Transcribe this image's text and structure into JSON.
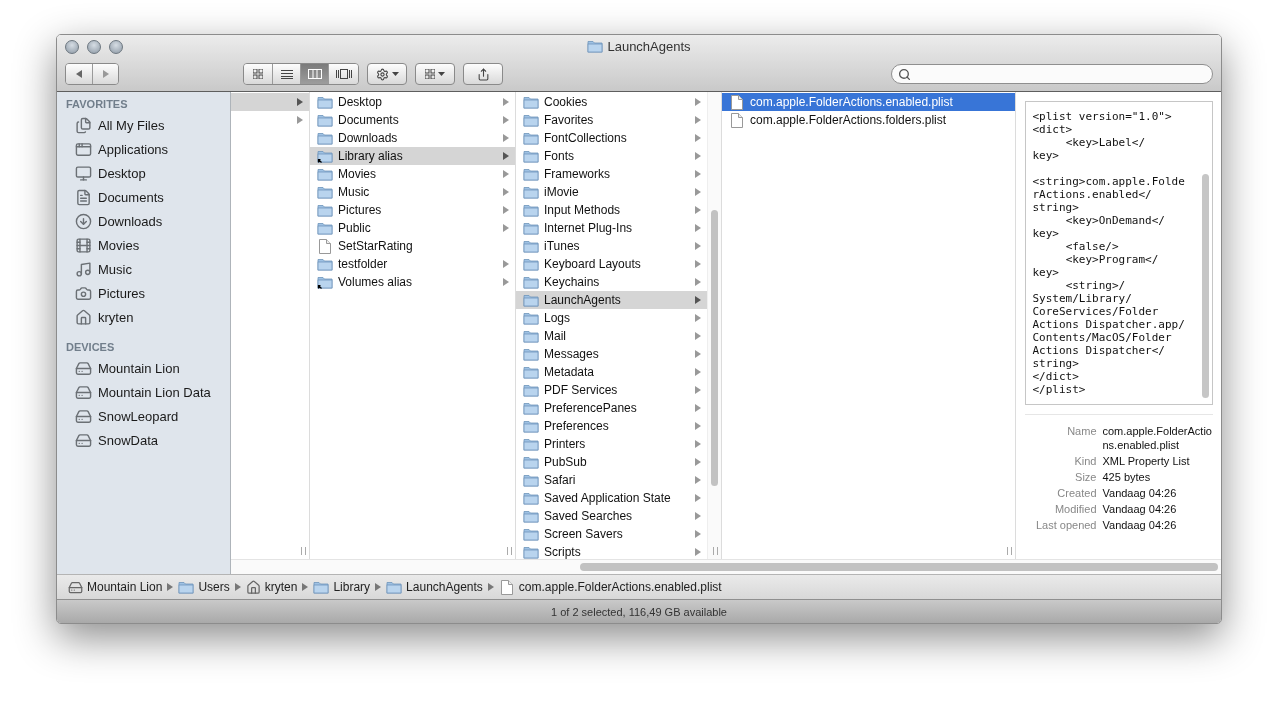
{
  "window": {
    "title": "LaunchAgents"
  },
  "toolbar": {
    "view_modes": [
      {
        "selected": false
      },
      {
        "selected": false
      },
      {
        "selected": true
      },
      {
        "selected": false
      }
    ]
  },
  "sidebar": {
    "sections": [
      {
        "heading": "FAVORITES",
        "items": [
          {
            "label": "All My Files"
          },
          {
            "label": "Applications"
          },
          {
            "label": "Desktop"
          },
          {
            "label": "Documents"
          },
          {
            "label": "Downloads"
          },
          {
            "label": "Movies"
          },
          {
            "label": "Music"
          },
          {
            "label": "Pictures"
          },
          {
            "label": "kryten"
          }
        ]
      },
      {
        "heading": "DEVICES",
        "items": [
          {
            "label": "Mountain Lion"
          },
          {
            "label": "Mountain Lion Data"
          },
          {
            "label": "SnowLeopard"
          },
          {
            "label": "SnowData"
          }
        ]
      }
    ]
  },
  "columns": [
    {
      "focused": false,
      "rows": [
        {
          "kind": "blank",
          "has_children": true,
          "selected": true
        },
        {
          "kind": "blank",
          "has_children": true,
          "selected": false
        }
      ]
    },
    {
      "focused": false,
      "rows": [
        {
          "label": "Desktop",
          "kind": "folder",
          "alias": false,
          "has_children": true,
          "selected": false
        },
        {
          "label": "Documents",
          "kind": "folder",
          "alias": false,
          "has_children": true,
          "selected": false
        },
        {
          "label": "Downloads",
          "kind": "folder",
          "alias": false,
          "has_children": true,
          "selected": false
        },
        {
          "label": "Library alias",
          "kind": "folder",
          "alias": true,
          "has_children": true,
          "selected": true
        },
        {
          "label": "Movies",
          "kind": "folder",
          "alias": false,
          "has_children": true,
          "selected": false
        },
        {
          "label": "Music",
          "kind": "folder",
          "alias": false,
          "has_children": true,
          "selected": false
        },
        {
          "label": "Pictures",
          "kind": "folder",
          "alias": false,
          "has_children": true,
          "selected": false
        },
        {
          "label": "Public",
          "kind": "folder",
          "alias": false,
          "has_children": true,
          "selected": false
        },
        {
          "label": "SetStarRating",
          "kind": "file",
          "alias": false,
          "has_children": false,
          "selected": false
        },
        {
          "label": "testfolder",
          "kind": "folder",
          "alias": false,
          "has_children": true,
          "selected": false
        },
        {
          "label": "Volumes alias",
          "kind": "folder",
          "alias": true,
          "has_children": true,
          "selected": false
        }
      ]
    },
    {
      "focused": false,
      "rows": [
        {
          "label": "Cookies",
          "kind": "folder",
          "alias": false,
          "has_children": true,
          "selected": false
        },
        {
          "label": "Favorites",
          "kind": "folder",
          "alias": false,
          "has_children": true,
          "selected": false
        },
        {
          "label": "FontCollections",
          "kind": "folder",
          "alias": false,
          "has_children": true,
          "selected": false
        },
        {
          "label": "Fonts",
          "kind": "folder",
          "alias": false,
          "has_children": true,
          "selected": false
        },
        {
          "label": "Frameworks",
          "kind": "folder",
          "alias": false,
          "has_children": true,
          "selected": false
        },
        {
          "label": "iMovie",
          "kind": "folder",
          "alias": false,
          "has_children": true,
          "selected": false
        },
        {
          "label": "Input Methods",
          "kind": "folder",
          "alias": false,
          "has_children": true,
          "selected": false
        },
        {
          "label": "Internet Plug-Ins",
          "kind": "folder",
          "alias": false,
          "has_children": true,
          "selected": false
        },
        {
          "label": "iTunes",
          "kind": "folder",
          "alias": false,
          "has_children": true,
          "selected": false
        },
        {
          "label": "Keyboard Layouts",
          "kind": "folder",
          "alias": false,
          "has_children": true,
          "selected": false
        },
        {
          "label": "Keychains",
          "kind": "folder",
          "alias": false,
          "has_children": true,
          "selected": false
        },
        {
          "label": "LaunchAgents",
          "kind": "folder",
          "alias": false,
          "has_children": true,
          "selected": true
        },
        {
          "label": "Logs",
          "kind": "folder",
          "alias": false,
          "has_children": true,
          "selected": false
        },
        {
          "label": "Mail",
          "kind": "folder",
          "alias": false,
          "has_children": true,
          "selected": false
        },
        {
          "label": "Messages",
          "kind": "folder",
          "alias": false,
          "has_children": true,
          "selected": false
        },
        {
          "label": "Metadata",
          "kind": "folder",
          "alias": false,
          "has_children": true,
          "selected": false
        },
        {
          "label": "PDF Services",
          "kind": "folder",
          "alias": false,
          "has_children": true,
          "selected": false
        },
        {
          "label": "PreferencePanes",
          "kind": "folder",
          "alias": false,
          "has_children": true,
          "selected": false
        },
        {
          "label": "Preferences",
          "kind": "folder",
          "alias": false,
          "has_children": true,
          "selected": false
        },
        {
          "label": "Printers",
          "kind": "folder",
          "alias": false,
          "has_children": true,
          "selected": false
        },
        {
          "label": "PubSub",
          "kind": "folder",
          "alias": false,
          "has_children": true,
          "selected": false
        },
        {
          "label": "Safari",
          "kind": "folder",
          "alias": false,
          "has_children": true,
          "selected": false
        },
        {
          "label": "Saved Application State",
          "kind": "folder",
          "alias": false,
          "has_children": true,
          "selected": false
        },
        {
          "label": "Saved Searches",
          "kind": "folder",
          "alias": false,
          "has_children": true,
          "selected": false
        },
        {
          "label": "Screen Savers",
          "kind": "folder",
          "alias": false,
          "has_children": true,
          "selected": false
        },
        {
          "label": "Scripts",
          "kind": "folder",
          "alias": false,
          "has_children": true,
          "selected": false
        }
      ]
    },
    {
      "focused": true,
      "rows": [
        {
          "label": "com.apple.FolderActions.enabled.plist",
          "kind": "file",
          "alias": false,
          "has_children": false,
          "selected": true
        },
        {
          "label": "com.apple.FolderActions.folders.plist",
          "kind": "file",
          "alias": false,
          "has_children": false,
          "selected": false
        }
      ]
    }
  ],
  "preview": {
    "code": "<plist version=\"1.0\">\n<dict>\n\t<key>Label</\nkey>\n\n<string>com.apple.Folde\nrActions.enabled</\nstring>\n\t<key>OnDemand</\nkey>\n\t<false/>\n\t<key>Program</\nkey>\n\t<string>/\nSystem/Library/\nCoreServices/Folder\nActions Dispatcher.app/\nContents/MacOS/Folder\nActions Dispatcher</\nstring>\n</dict>\n</plist>",
    "info": [
      {
        "label": "Name",
        "value": "com.apple.FolderActions.enabled.plist"
      },
      {
        "label": "Kind",
        "value": "XML Property List"
      },
      {
        "label": "Size",
        "value": "425 bytes"
      },
      {
        "label": "Created",
        "value": "Vandaag 04:26"
      },
      {
        "label": "Modified",
        "value": "Vandaag 04:26"
      },
      {
        "label": "Last opened",
        "value": "Vandaag 04:26"
      }
    ]
  },
  "path_bar": [
    {
      "label": "Mountain Lion"
    },
    {
      "label": "Users"
    },
    {
      "label": "kryten"
    },
    {
      "label": "Library"
    },
    {
      "label": "LaunchAgents"
    },
    {
      "label": "com.apple.FolderActions.enabled.plist"
    }
  ],
  "status_bar": {
    "text": "1 of 2 selected, 116,49 GB available"
  }
}
